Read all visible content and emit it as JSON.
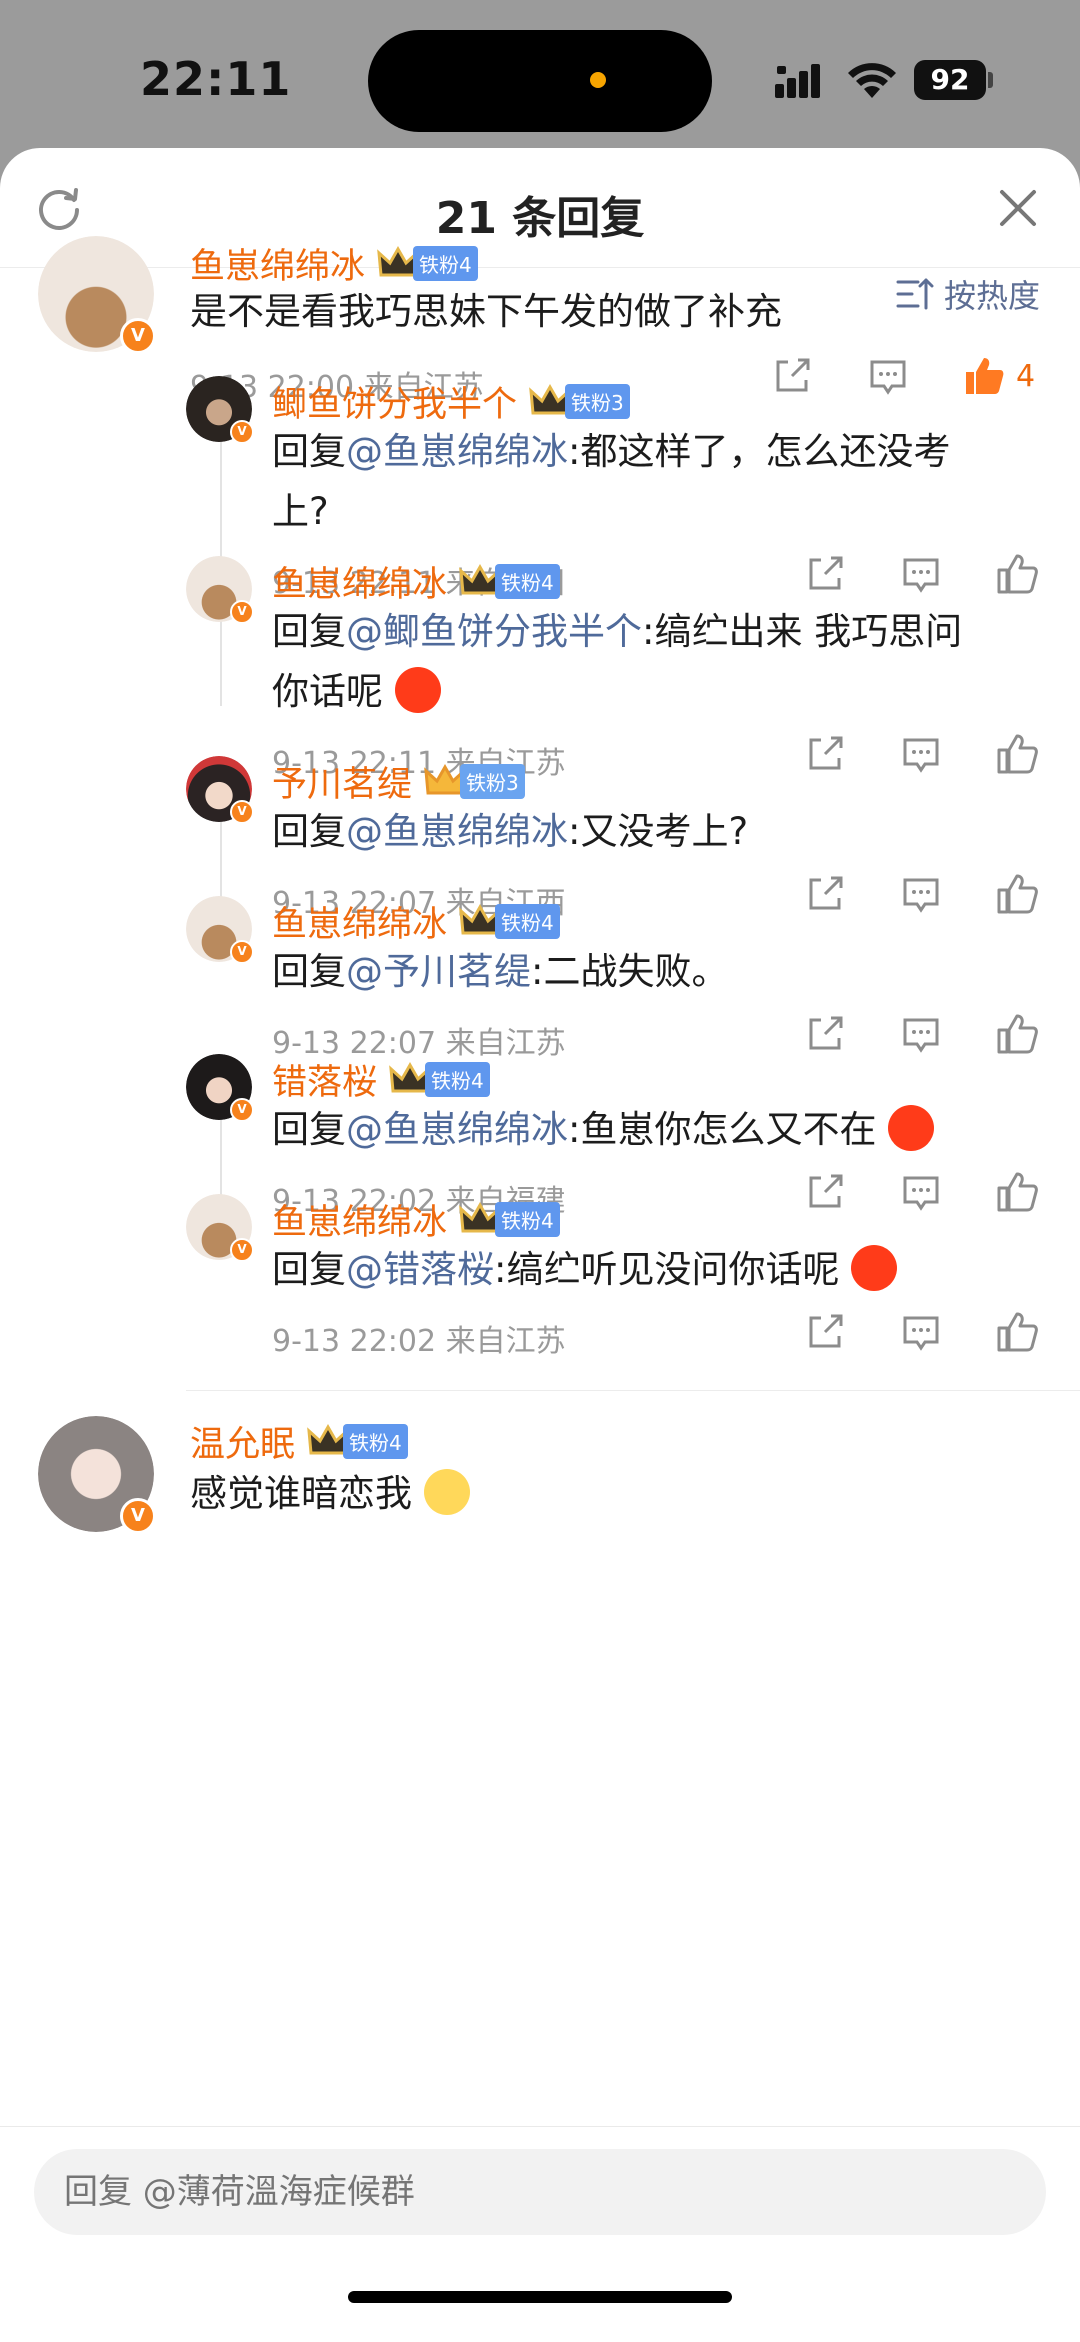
{
  "status_bar": {
    "time": "22:11",
    "battery": "92"
  },
  "header": {
    "title": "21 条回复"
  },
  "sort": {
    "label": "按热度"
  },
  "main_comment": {
    "name": "鱼崽绵绵冰",
    "fan_level": "铁粉4",
    "text": "是不是看我巧思妹下午发的做了补充",
    "meta": "9-13 22:00 来自江苏",
    "likes": "4"
  },
  "replies": [
    {
      "name": "鲫鱼饼分我半个",
      "fan_level": "铁粉3",
      "prefix": "回复",
      "at": "@鱼崽绵绵冰",
      "text1": ":都这样了，怎么还没考",
      "text2": "上?",
      "meta": "9-13 22:11 来自四川"
    },
    {
      "name": "鱼崽绵绵冰",
      "fan_level": "铁粉4",
      "prefix": "回复",
      "at": "@鲫鱼饼分我半个",
      "text1": ":缟纻出来 我巧思问",
      "text2": "你话呢",
      "meta": "9-13 22:11 来自江苏"
    },
    {
      "name": "予川茗缇",
      "fan_level": "铁粉3",
      "prefix": "回复",
      "at": "@鱼崽绵绵冰",
      "text1": ":又没考上?",
      "meta": "9-13 22:07 来自江西"
    },
    {
      "name": "鱼崽绵绵冰",
      "fan_level": "铁粉4",
      "prefix": "回复",
      "at": "@予川茗缇",
      "text1": ":二战失败。",
      "meta": "9-13 22:07 来自江苏"
    },
    {
      "name": "错落桜",
      "fan_level": "铁粉4",
      "prefix": "回复",
      "at": "@鱼崽绵绵冰",
      "text1": ":鱼崽你怎么又不在",
      "meta": "9-13 22:02 来自福建"
    },
    {
      "name": "鱼崽绵绵冰",
      "fan_level": "铁粉4",
      "prefix": "回复",
      "at": "@错落桜",
      "text1": ":缟纻听见没问你话呢",
      "meta": "9-13 22:02 来自江苏"
    }
  ],
  "next_comment": {
    "name": "温允眠",
    "fan_level": "铁粉4",
    "text": "感觉谁暗恋我"
  },
  "reply_bar": {
    "placeholder": "回复 @薄荷溫海症候群"
  },
  "badges": {
    "verified": "V"
  }
}
